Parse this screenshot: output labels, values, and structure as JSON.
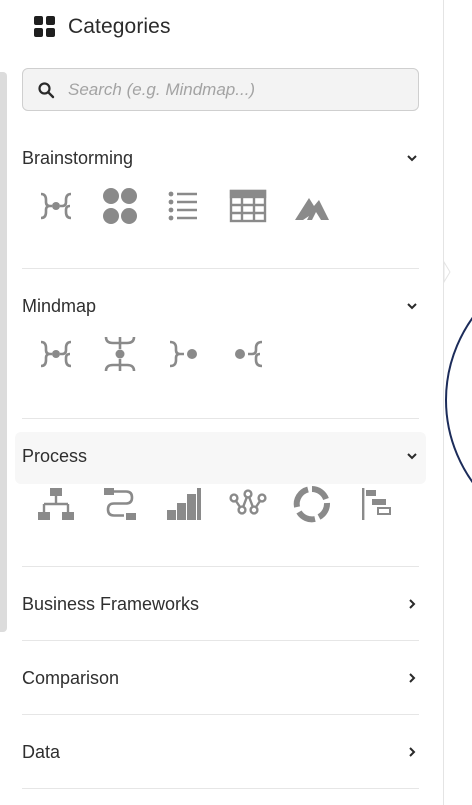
{
  "header": {
    "title": "Categories",
    "icon": "grid-icon"
  },
  "search": {
    "placeholder": "Search (e.g. Mindmap...)"
  },
  "sections": {
    "brainstorming": {
      "title": "Brainstorming",
      "expanded": true,
      "icons": [
        "mindmap-both-sides-icon",
        "four-circles-icon",
        "bullet-list-icon",
        "table-grid-icon",
        "peak-chart-icon"
      ]
    },
    "mindmap": {
      "title": "Mindmap",
      "expanded": true,
      "icons": [
        "mindmap-both-sides-icon",
        "tree-vertical-icon",
        "mindmap-right-icon",
        "mindmap-left-icon"
      ]
    },
    "process": {
      "title": "Process",
      "expanded": true,
      "icons": [
        "org-chart-icon",
        "flow-zigzag-icon",
        "stair-steps-icon",
        "path-nodes-icon",
        "cycle-ring-icon",
        "gantt-bars-icon"
      ]
    },
    "business": {
      "title": "Business Frameworks",
      "expanded": false
    },
    "comparison": {
      "title": "Comparison",
      "expanded": false
    },
    "data": {
      "title": "Data",
      "expanded": false
    }
  },
  "colors": {
    "icon": "#8a8a8a",
    "text": "#2f2f2f",
    "divider": "#e6e6e6",
    "canvas_stroke": "#1c2c5a"
  }
}
